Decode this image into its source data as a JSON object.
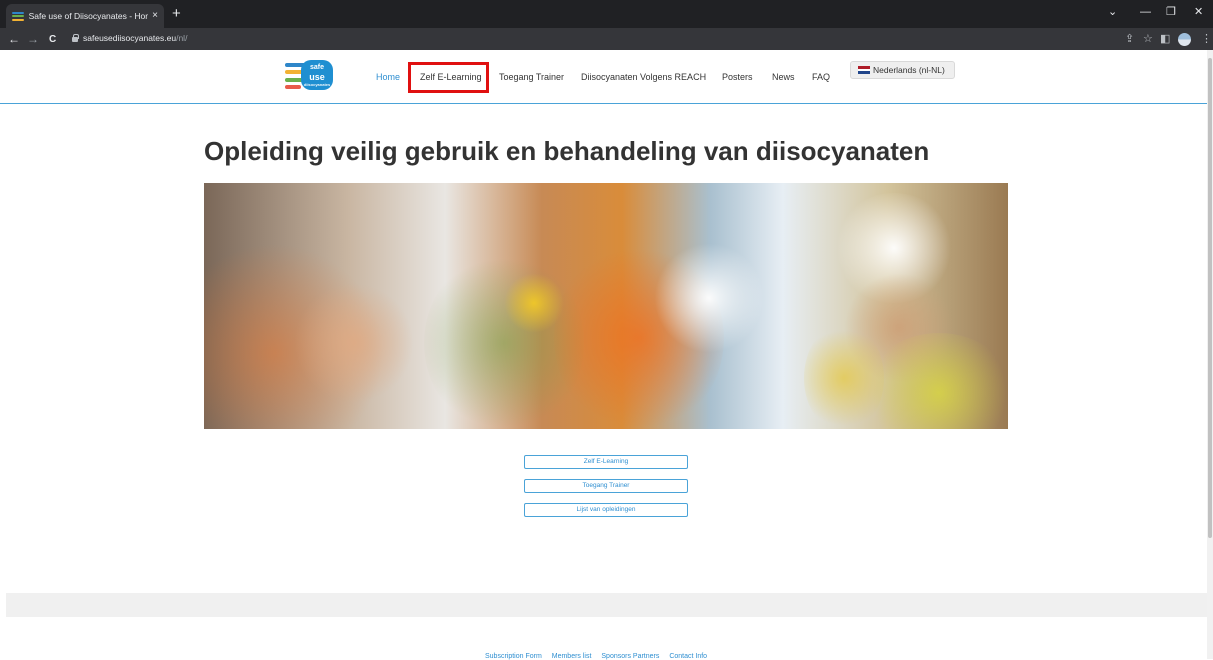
{
  "browser": {
    "tab_title": "Safe use of Diisocyanates - Home",
    "tab_close": "×",
    "new_tab": "+",
    "url_host": "safeusediisocyanates.eu",
    "url_path": "/nl/",
    "nav_back": "←",
    "nav_forward": "→",
    "nav_reload": "C",
    "window_controls": [
      "⌄",
      "—",
      "❐",
      "✕"
    ],
    "toolbar_icons": [
      "⇪",
      "☆",
      "◧",
      "⋮"
    ]
  },
  "logo": {
    "line1": "safe",
    "line2": "use",
    "line3": "diisocyanates",
    "colors": [
      "#2e86c9",
      "#f2b233",
      "#6ab04c",
      "#e85b4a"
    ]
  },
  "nav": {
    "items": [
      {
        "label": "Home",
        "active": true
      },
      {
        "label": "Zelf E-Learning",
        "highlighted": true
      },
      {
        "label": "Toegang Trainer"
      },
      {
        "label": "Diisocyanaten Volgens REACH"
      },
      {
        "label": "Posters"
      },
      {
        "label": "News"
      },
      {
        "label": "FAQ"
      }
    ],
    "language": "Nederlands (nl-NL)",
    "flag_colors": [
      "#ae1c28",
      "#ffffff",
      "#21468b"
    ]
  },
  "headline": "Opleiding veilig gebruik en behandeling van diisocyanaten",
  "buttons": {
    "elearning": "Zelf E-Learning",
    "trainer": "Toegang Trainer",
    "courses": "Lijst van opleidingen"
  },
  "footer": {
    "links": [
      "Subscription Form",
      "Members list",
      "Sponsors Partners",
      "Contact Info"
    ]
  },
  "colors": {
    "accent": "#2f8fd1",
    "highlight": "#e01010"
  }
}
